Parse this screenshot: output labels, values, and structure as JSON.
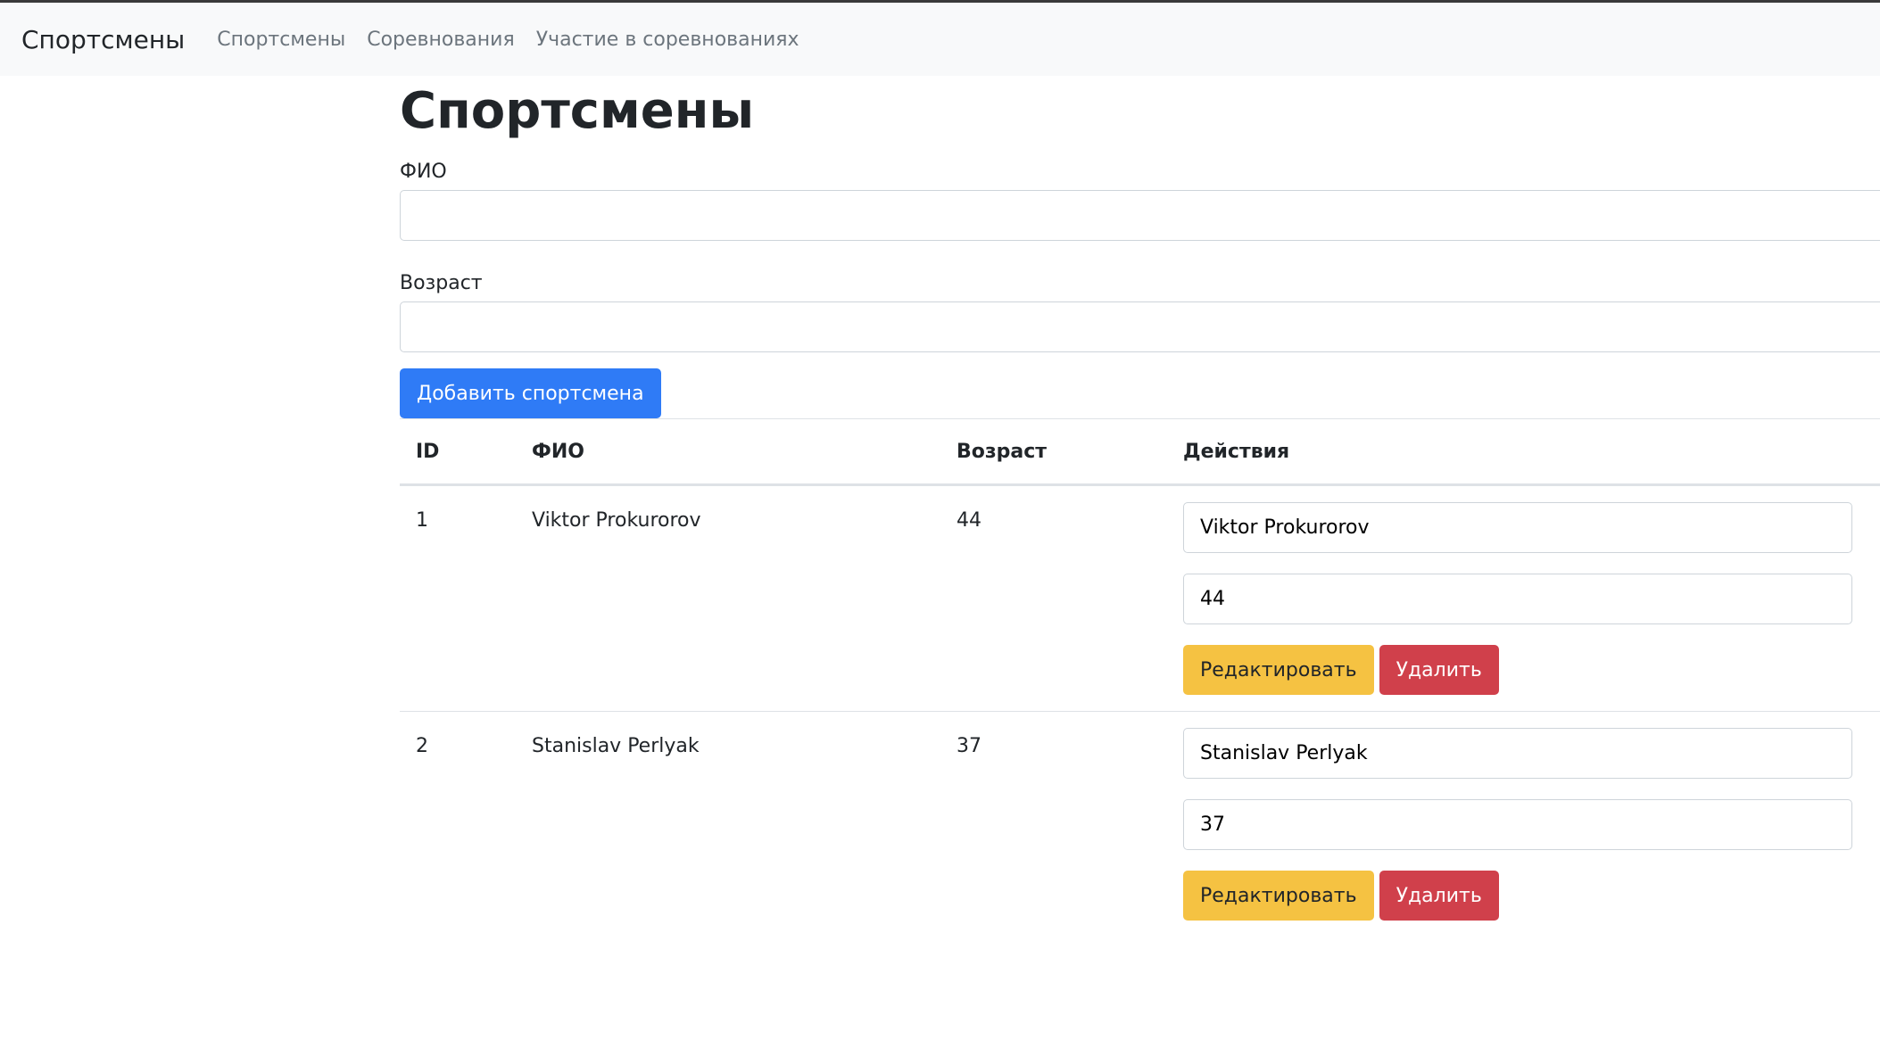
{
  "navbar": {
    "brand": "Спортсмены",
    "links": [
      "Спортсмены",
      "Соревнования",
      "Участие в соревнованиях"
    ]
  },
  "page_title": "Спортсмены",
  "form": {
    "name_label": "ФИО",
    "name_value": "",
    "age_label": "Возраст",
    "age_value": "",
    "add_button": "Добавить спортсмена"
  },
  "table": {
    "headers": [
      "ID",
      "ФИО",
      "Возраст",
      "Действия"
    ],
    "rows": [
      {
        "id": "1",
        "name": "Viktor Prokurorov",
        "age": "44",
        "edit_name": "Viktor Prokurorov",
        "edit_age": "44",
        "edit_label": "Редактировать",
        "delete_label": "Удалить"
      },
      {
        "id": "2",
        "name": "Stanislav Perlyak",
        "age": "37",
        "edit_name": "Stanislav Perlyak",
        "edit_age": "37",
        "edit_label": "Редактировать",
        "delete_label": "Удалить"
      }
    ]
  },
  "colors": {
    "primary": "#2f7bf6",
    "warning": "#f5c242",
    "danger": "#d0404b",
    "navbar_bg": "#f8f9fa"
  }
}
